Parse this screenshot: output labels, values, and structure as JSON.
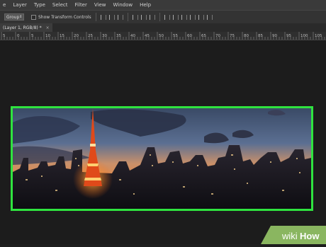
{
  "menu": {
    "items": [
      "e",
      "Layer",
      "Type",
      "Select",
      "Filter",
      "View",
      "Window",
      "Help"
    ]
  },
  "options": {
    "group_select": "Group",
    "show_transform_label": "Show Transform Controls"
  },
  "document_tab": {
    "title": "(Layer 1, RGB/8) *",
    "close": "×"
  },
  "ruler": {
    "labels": [
      "5",
      "0",
      "5",
      "10",
      "15",
      "20",
      "25",
      "30",
      "35",
      "40",
      "45",
      "50",
      "55",
      "60",
      "65",
      "70",
      "75",
      "80",
      "85",
      "90",
      "95",
      "100",
      "105"
    ]
  },
  "image": {
    "description_icon": "cityscape-image",
    "border_color": "#2fe33f"
  },
  "watermark": {
    "text_wiki": "wiki",
    "text_how": "How"
  },
  "colors": {
    "menubar": "#3a3a3a",
    "canvas": "#1c1c1c",
    "accent_green": "#2fe33f"
  }
}
